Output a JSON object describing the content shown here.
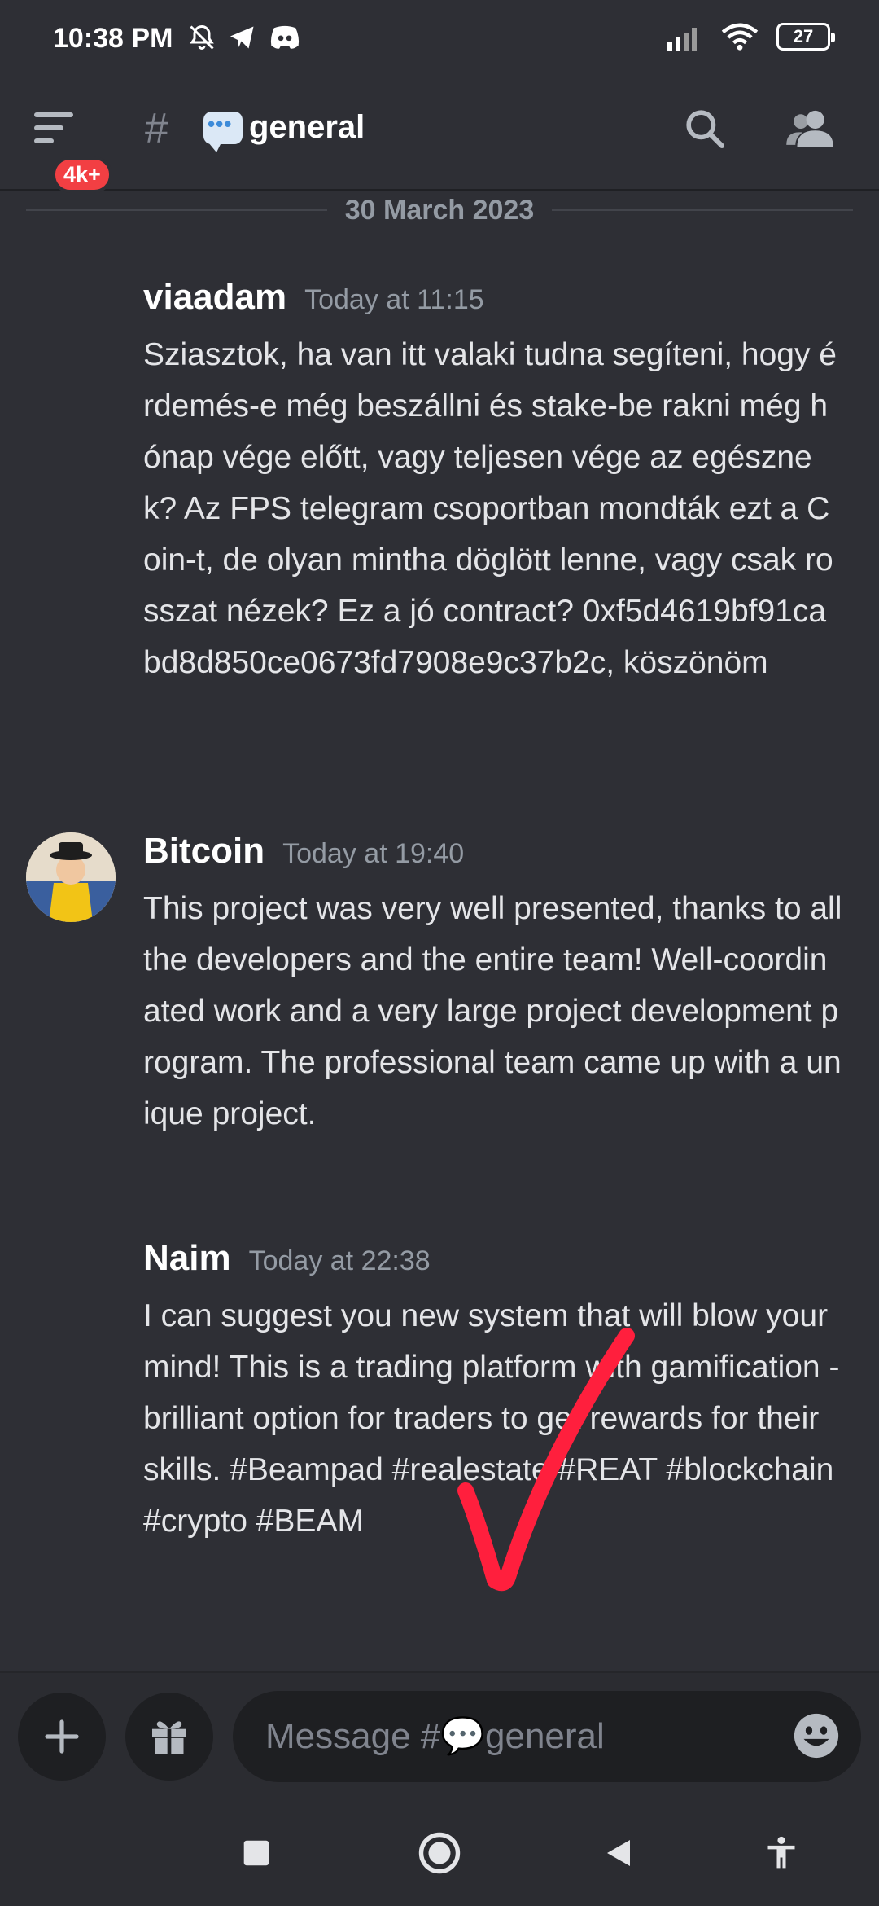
{
  "status_bar": {
    "time": "10:38 PM",
    "left_icons": [
      "mute-bell-icon",
      "telegram-icon",
      "discord-icon"
    ],
    "right_icons": [
      "signal-icon",
      "wifi-icon",
      "battery-icon"
    ],
    "battery_level": "27"
  },
  "header": {
    "menu_icon": "channels-menu-icon",
    "unread_badge": "4k+",
    "channel_prefix": "#",
    "channel_name": "general",
    "actions": [
      "search-icon",
      "members-icon"
    ]
  },
  "date_divider": "30 March 2023",
  "messages": [
    {
      "author": "viaadam",
      "timestamp": "Today at 11:15",
      "text": "Sziasztok, ha van itt valaki tudna segíteni, hogy érdemés-e még beszállni és stake-be rakni még hónap vége előtt, vagy teljesen vége az egésznek? Az FPS telegram csoportban mondták ezt a Coin-t, de olyan mintha döglött lenne, vagy csak rosszat nézek? Ez a jó contract? 0xf5d4619bf91cabd8d850ce0673fd7908e9c37b2c, köszönöm"
    },
    {
      "author": "Bitcoin",
      "timestamp": "Today at 19:40",
      "text": "This project was very well presented, thanks to all the developers and the entire team! Well-coordinated work and a very large project development program. The professional team came up with a unique project."
    },
    {
      "author": "Naim",
      "timestamp": "Today at 22:38",
      "text": "I can suggest you new  system that will blow your mind! This is a trading platform with gamification - brilliant option for traders to get rewards for their skills. #Beampad #realestate #REAT #blockchain #crypto #BEAM"
    }
  ],
  "composer": {
    "placeholder": "Message #💬general",
    "left_buttons": [
      "plus-icon",
      "gift-icon"
    ],
    "right_button": "emoji-icon"
  },
  "nav_bar": [
    "recents-icon",
    "home-icon",
    "back-icon",
    "accessibility-icon"
  ],
  "colors": {
    "background": "#2e2f35",
    "badge": "#f23f43",
    "input_bg": "#1e1f22",
    "annotation_check": "#ff1f3d"
  }
}
